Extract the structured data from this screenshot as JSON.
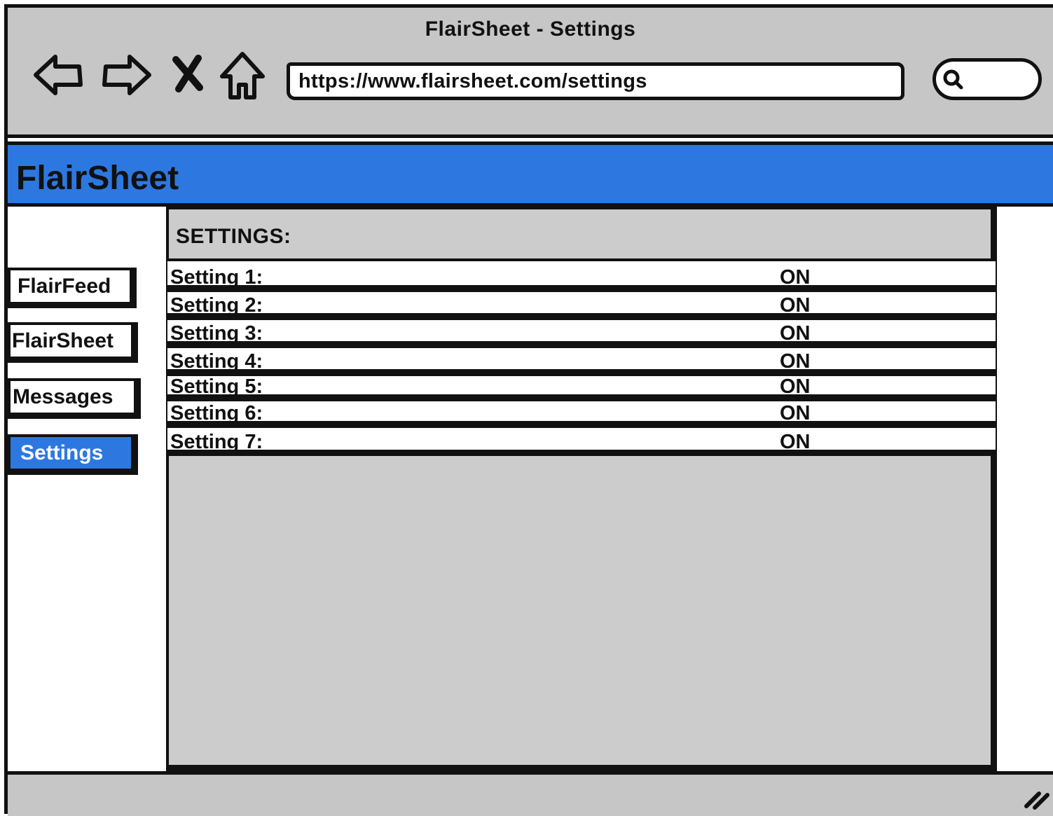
{
  "window": {
    "title": "FlairSheet - Settings"
  },
  "browser": {
    "url": "https://www.flairsheet.com/settings",
    "search_value": "",
    "icons": [
      "back-arrow-icon",
      "forward-arrow-icon",
      "stop-icon",
      "home-icon",
      "search-icon",
      "resize-grip-icon"
    ]
  },
  "app": {
    "logo": "FlairSheet",
    "accent_color": "#2d78e0"
  },
  "sidebar": {
    "items": [
      {
        "label": "FlairFeed",
        "active": false
      },
      {
        "label": "FlairSheet",
        "active": false
      },
      {
        "label": "Messages",
        "active": false
      },
      {
        "label": "Settings",
        "active": true
      }
    ]
  },
  "main": {
    "title": "SETTINGS:",
    "settings": [
      {
        "label": "Setting 1:",
        "value": "ON"
      },
      {
        "label": "Setting 2:",
        "value": "ON"
      },
      {
        "label": "Setting 3:",
        "value": "ON"
      },
      {
        "label": "Setting 4:",
        "value": "ON"
      },
      {
        "label": "Setting 5:",
        "value": "ON"
      },
      {
        "label": "Setting 6:",
        "value": "ON"
      },
      {
        "label": "Setting 7:",
        "value": "ON"
      }
    ]
  }
}
